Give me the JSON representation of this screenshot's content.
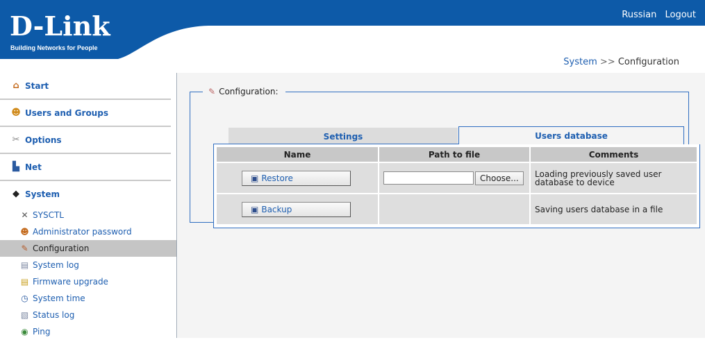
{
  "brand": {
    "logo_text": "D-Link",
    "tagline": "Building Networks for People"
  },
  "top_links": {
    "language": "Russian",
    "logout": "Logout"
  },
  "breadcrumb": {
    "parent": "System",
    "separator": ">>",
    "current": "Configuration"
  },
  "sidebar": {
    "sections": [
      {
        "label": "Start",
        "icon": "home-icon"
      },
      {
        "label": "Users and Groups",
        "icon": "users-icon"
      },
      {
        "label": "Options",
        "icon": "options-icon"
      },
      {
        "label": "Net",
        "icon": "network-icon"
      },
      {
        "label": "System",
        "icon": "system-icon"
      }
    ],
    "system_items": [
      {
        "label": "SYSCTL",
        "icon": "tools-icon",
        "active": false
      },
      {
        "label": "Administrator password",
        "icon": "user-key-icon",
        "active": false
      },
      {
        "label": "Configuration",
        "icon": "configuration-icon",
        "active": true
      },
      {
        "label": "System log",
        "icon": "log-icon",
        "active": false
      },
      {
        "label": "Firmware upgrade",
        "icon": "firmware-icon",
        "active": false
      },
      {
        "label": "System time",
        "icon": "clock-icon",
        "active": false
      },
      {
        "label": "Status log",
        "icon": "status-log-icon",
        "active": false
      },
      {
        "label": "Ping",
        "icon": "ping-icon",
        "active": false
      }
    ]
  },
  "panel": {
    "title": "Configuration:",
    "tabs": [
      {
        "label": "Settings",
        "selected": false
      },
      {
        "label": "Users database",
        "selected": true
      }
    ],
    "table": {
      "headers": [
        "Name",
        "Path to file",
        "Comments"
      ],
      "rows": [
        {
          "action": "Restore",
          "has_file": true,
          "file_value": "",
          "file_button": "Choose...",
          "comment": "Loading previously saved user database to device"
        },
        {
          "action": "Backup",
          "has_file": false,
          "comment": "Saving users database in a file"
        }
      ]
    }
  },
  "colors": {
    "header_blue": "#0d5aa8",
    "link_blue": "#1d5eb0",
    "border_blue": "#2d6cc0",
    "active_row": "#c5c5c5"
  }
}
